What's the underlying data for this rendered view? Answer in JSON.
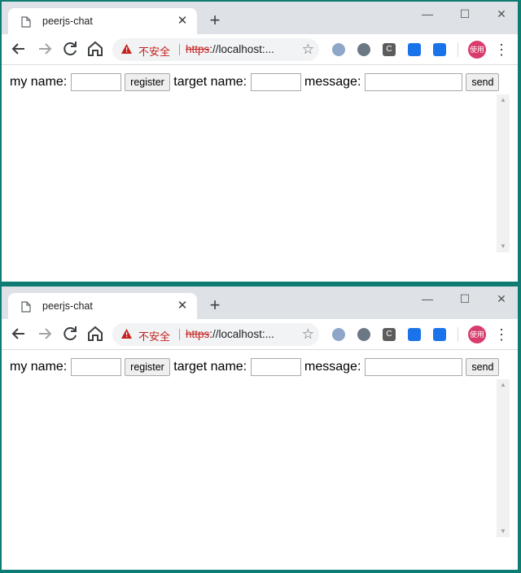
{
  "tab": {
    "title": "peerjs-chat"
  },
  "address": {
    "security_label": "不安全",
    "scheme": "https",
    "rest": "://localhost:..."
  },
  "extensions": {
    "c_label": "C"
  },
  "profile": {
    "avatar_text": "使用"
  },
  "form": {
    "my_name_label": "my name:",
    "my_name_value": "",
    "register_label": "register",
    "target_name_label": "target name:",
    "target_name_value": "",
    "message_label": "message:",
    "message_value": "",
    "send_label": "send"
  }
}
